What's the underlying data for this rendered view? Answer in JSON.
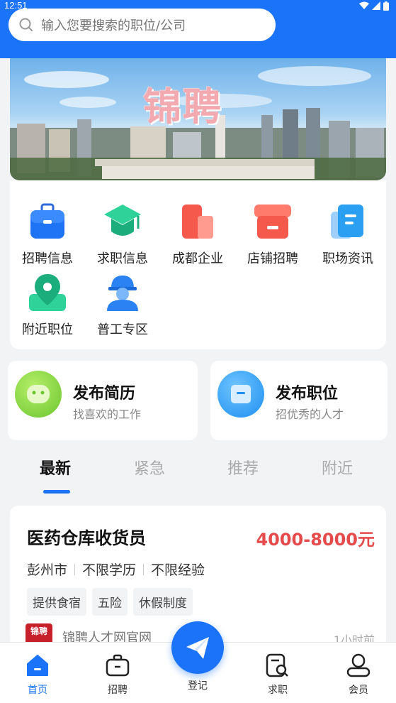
{
  "status_bar": {
    "time": "12:51"
  },
  "search": {
    "placeholder": "输入您要搜索的职位/公司"
  },
  "banner": {
    "title": "锦聘"
  },
  "categories": [
    {
      "label": "招聘信息",
      "icon": "briefcase-icon",
      "color": "#1f74f5"
    },
    {
      "label": "求职信息",
      "icon": "graduation-cap-icon",
      "color": "#22c08a"
    },
    {
      "label": "成都企业",
      "icon": "building-icon",
      "color": "#f5594c"
    },
    {
      "label": "店铺招聘",
      "icon": "store-icon",
      "color": "#f5594c"
    },
    {
      "label": "职场资讯",
      "icon": "document-icon",
      "color": "#2b9ff2"
    },
    {
      "label": "附近职位",
      "icon": "location-pin-icon",
      "color": "#22c08a"
    },
    {
      "label": "普工专区",
      "icon": "worker-helmet-icon",
      "color": "#2b82f2"
    }
  ],
  "publish": {
    "resume": {
      "title": "发布简历",
      "subtitle": "找喜欢的工作"
    },
    "job": {
      "title": "发布职位",
      "subtitle": "招优秀的人才"
    }
  },
  "tabs": [
    {
      "label": "最新",
      "active": true
    },
    {
      "label": "紧急",
      "active": false
    },
    {
      "label": "推荐",
      "active": false
    },
    {
      "label": "附近",
      "active": false
    }
  ],
  "job": {
    "title": "医药仓库收货员",
    "salary": "4000-8000元",
    "location": "彭州市",
    "education": "不限学历",
    "experience": "不限经验",
    "tags": [
      "提供食宿",
      "五险",
      "休假制度"
    ],
    "company_logo_text": "锦聘",
    "company": "锦聘人才网官网",
    "time": "1小时前"
  },
  "nav": {
    "home": "首页",
    "recruit": "招聘",
    "register": "登记",
    "jobseek": "求职",
    "member": "会员"
  },
  "colors": {
    "primary": "#1a73f8",
    "salary": "#e64b4b"
  }
}
